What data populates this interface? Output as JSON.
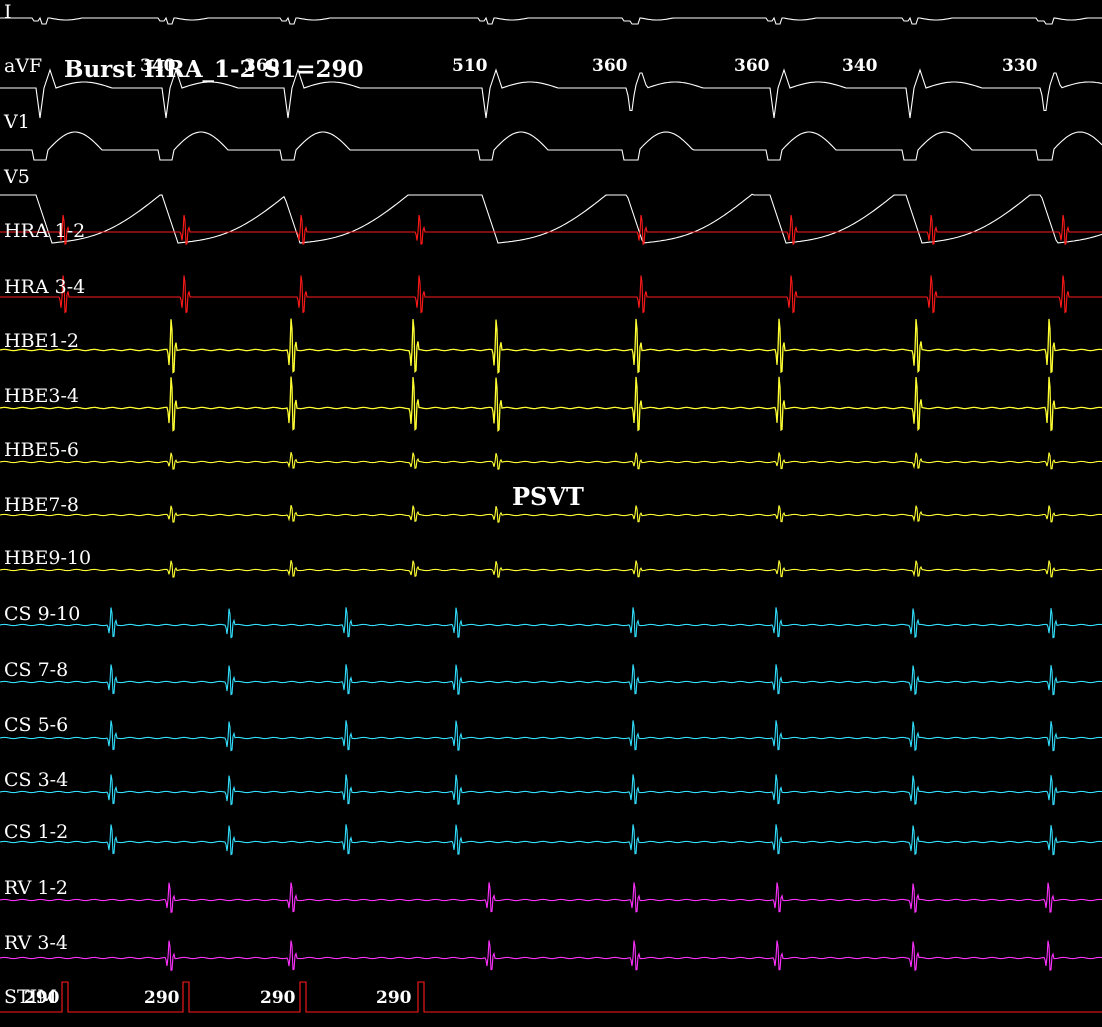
{
  "chart_data": {
    "type": "line",
    "title": "Burst HRA_1-2 S1=290",
    "annotation": "PSVT",
    "channels": [
      {
        "name": "I",
        "color": "#ffffff"
      },
      {
        "name": "aVF",
        "color": "#ffffff"
      },
      {
        "name": "V1",
        "color": "#ffffff"
      },
      {
        "name": "V5",
        "color": "#ffffff"
      },
      {
        "name": "HRA 1-2",
        "color": "#ff1a1a"
      },
      {
        "name": "HRA 3-4",
        "color": "#ff1a1a"
      },
      {
        "name": "HBE1-2",
        "color": "#ffff33"
      },
      {
        "name": "HBE3-4",
        "color": "#ffff33"
      },
      {
        "name": "HBE5-6",
        "color": "#ffff33"
      },
      {
        "name": "HBE7-8",
        "color": "#ffff33"
      },
      {
        "name": "HBE9-10",
        "color": "#ffff33"
      },
      {
        "name": "CS 9-10",
        "color": "#33e0ff"
      },
      {
        "name": "CS 7-8",
        "color": "#33e0ff"
      },
      {
        "name": "CS 5-6",
        "color": "#33e0ff"
      },
      {
        "name": "CS 3-4",
        "color": "#33e0ff"
      },
      {
        "name": "CS 1-2",
        "color": "#33e0ff"
      },
      {
        "name": "RV 1-2",
        "color": "#ff33ff"
      },
      {
        "name": "RV 3-4",
        "color": "#ff33ff"
      },
      {
        "name": "STIM",
        "color": "#ff1a1a"
      }
    ],
    "qrs_intervals_ms": [
      "340",
      "360",
      "510",
      "360",
      "360",
      "340",
      "330"
    ],
    "stim_intervals_ms": [
      "290",
      "290",
      "290",
      "290"
    ],
    "stimulus_count": 5,
    "rhythm": "PSVT"
  }
}
